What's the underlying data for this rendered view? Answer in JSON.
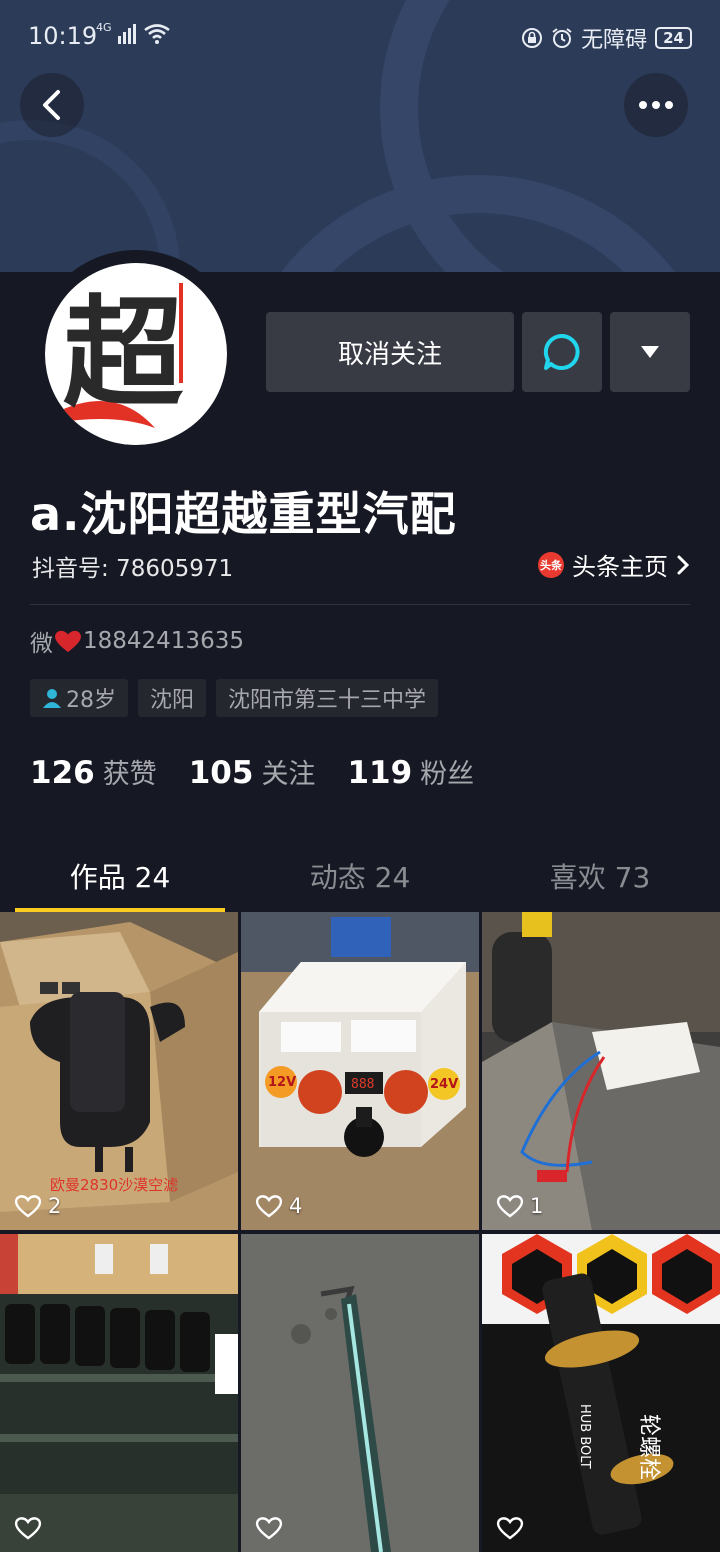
{
  "status_bar": {
    "time": "10:19",
    "network": "4G",
    "accessibility": "无障碍",
    "battery": "24"
  },
  "profile": {
    "avatar_text": "超",
    "name": "a.沈阳超越重型汽配",
    "douyin_id_label": "抖音号: 78605971",
    "toutiao_badge": "头条",
    "toutiao_label": "头条主页",
    "bio_prefix": "微",
    "bio_number": "18842413635",
    "tags": {
      "age": "28岁",
      "city": "沈阳",
      "school": "沈阳市第三十三中学"
    }
  },
  "actions": {
    "unfollow_label": "取消关注"
  },
  "stats": {
    "likes_num": "126",
    "likes_label": "获赞",
    "following_num": "105",
    "following_label": "关注",
    "followers_num": "119",
    "followers_label": "粉丝"
  },
  "tabs": {
    "works": "作品 24",
    "moments": "动态 24",
    "liked": "喜欢 73"
  },
  "videos": [
    {
      "likes": "2",
      "caption": "欧曼2830沙漠空滤"
    },
    {
      "likes": "4",
      "left_label": "12V",
      "right_label": "24V"
    },
    {
      "likes": "1"
    },
    {
      "likes": ""
    },
    {
      "likes": ""
    },
    {
      "likes": "",
      "caption": "HUB BOLT"
    }
  ],
  "colors": {
    "background": "#161823",
    "banner": "#2c3b58",
    "tab_indicator": "#fbcb22",
    "chat_icon": "#20d5ec",
    "heart": "#d8262d"
  }
}
